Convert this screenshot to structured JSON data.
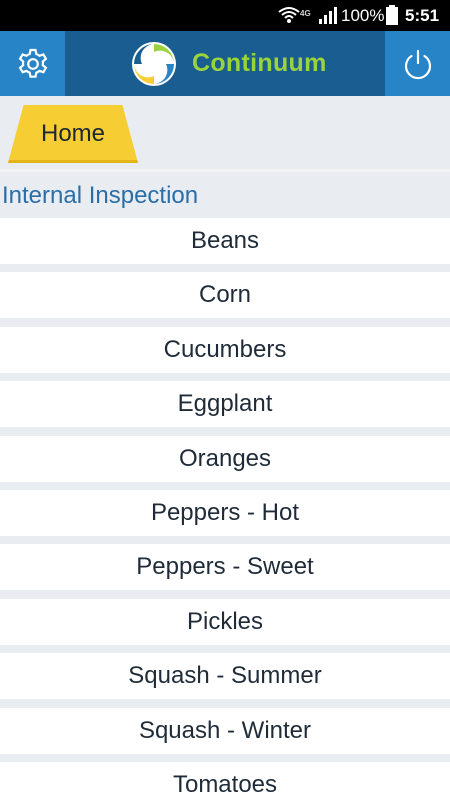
{
  "status_bar": {
    "network_label": "4G",
    "battery_percent": "100%",
    "time": "5:51"
  },
  "header": {
    "app_title": "Continuum",
    "settings_icon": "gear-icon",
    "power_icon": "power-icon",
    "brand_color": "#9bd33a",
    "header_color": "#1a5d91"
  },
  "tabs": {
    "home_label": "Home",
    "home_color": "#f6cd32"
  },
  "section": {
    "title": "Internal Inspection"
  },
  "items": [
    {
      "label": "Beans"
    },
    {
      "label": "Corn"
    },
    {
      "label": "Cucumbers"
    },
    {
      "label": "Eggplant"
    },
    {
      "label": "Oranges"
    },
    {
      "label": "Peppers - Hot"
    },
    {
      "label": "Peppers - Sweet"
    },
    {
      "label": "Pickles"
    },
    {
      "label": "Squash - Summer"
    },
    {
      "label": "Squash - Winter"
    },
    {
      "label": "Tomatoes"
    }
  ]
}
